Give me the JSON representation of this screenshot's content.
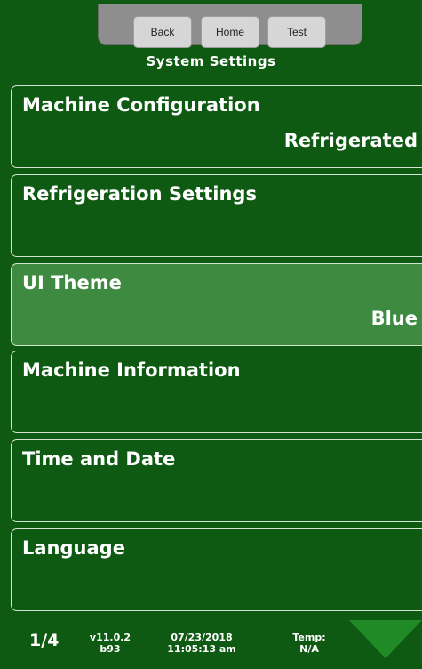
{
  "nav": {
    "back_label": "Back",
    "home_label": "Home",
    "test_label": "Test"
  },
  "page_title": "System Settings",
  "menu": [
    {
      "label": "Machine Configuration",
      "value": "Refrigerated"
    },
    {
      "label": "Refrigeration Settings",
      "value": ""
    },
    {
      "label": "UI Theme",
      "value": "Blue",
      "selected": true
    },
    {
      "label": "Machine Information",
      "value": ""
    },
    {
      "label": "Time and Date",
      "value": ""
    },
    {
      "label": "Language",
      "value": ""
    }
  ],
  "footer": {
    "page": "1/4",
    "version": "v11.0.2",
    "build": "b93",
    "date": "07/23/2018",
    "time": "11:05:13 am",
    "temp_label": "Temp:",
    "temp_value": "N/A"
  },
  "colors": {
    "background": "#0f5a13",
    "selected": "#3e8a41",
    "arrow": "#1f8a26"
  },
  "icons": {
    "next": "down-arrow-icon"
  }
}
